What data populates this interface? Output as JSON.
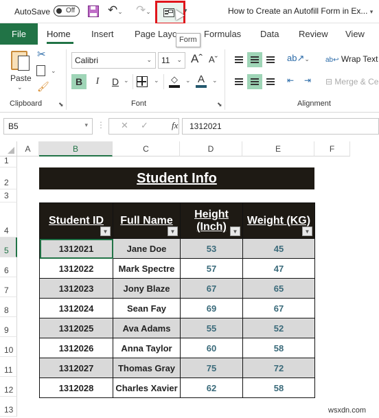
{
  "titlebar": {
    "autosave_label": "AutoSave",
    "autosave_state": "Off",
    "document_title": "How to Create an Autofill Form in Ex...",
    "form_tooltip": "Form"
  },
  "tabs": [
    {
      "label": "File"
    },
    {
      "label": "Home",
      "active": true
    },
    {
      "label": "Insert"
    },
    {
      "label": "Page Layo"
    },
    {
      "label": "Formulas"
    },
    {
      "label": "Data"
    },
    {
      "label": "Review"
    },
    {
      "label": "View"
    }
  ],
  "ribbon": {
    "clipboard": {
      "label": "Clipboard",
      "paste_label": "Paste"
    },
    "font": {
      "label": "Font",
      "font_name": "Calibri",
      "font_size": "11",
      "bold": "B",
      "italic": "I",
      "underline": "D"
    },
    "alignment": {
      "label": "Alignment",
      "wrap_text": "Wrap Text",
      "merge": "Merge & Ce"
    }
  },
  "formula_bar": {
    "name_box": "B5",
    "fx": "fx",
    "value": "1312021"
  },
  "grid": {
    "columns": [
      "A",
      "B",
      "C",
      "D",
      "E",
      "F"
    ],
    "selected_column": "B",
    "rows": [
      "1",
      "2",
      "3",
      "4",
      "5",
      "6",
      "7",
      "8",
      "9",
      "10",
      "11",
      "12",
      "13"
    ],
    "selected_row": "5",
    "active_cell": "B5"
  },
  "sheet": {
    "title": "Student Info",
    "headers": [
      "Student ID",
      "Full Name",
      "Height (Inch)",
      "Weight (KG)"
    ],
    "rows": [
      [
        "1312021",
        "Jane Doe",
        "53",
        "45"
      ],
      [
        "1312022",
        "Mark Spectre",
        "57",
        "47"
      ],
      [
        "1312023",
        "Jony Blaze",
        "67",
        "65"
      ],
      [
        "1312024",
        "Sean Fay",
        "69",
        "67"
      ],
      [
        "1312025",
        "Ava Adams",
        "55",
        "52"
      ],
      [
        "1312026",
        "Anna Taylor",
        "60",
        "58"
      ],
      [
        "1312027",
        "Thomas Gray",
        "75",
        "72"
      ],
      [
        "1312028",
        "Charles Xavier",
        "62",
        "58"
      ]
    ]
  },
  "watermark": "wsxdn.com",
  "colors": {
    "excel_green": "#217346",
    "header_dark": "#1e1a14",
    "highlight_red": "#e0151b",
    "row_shade": "#d9d9d9",
    "number_color": "#3a6a7a"
  }
}
